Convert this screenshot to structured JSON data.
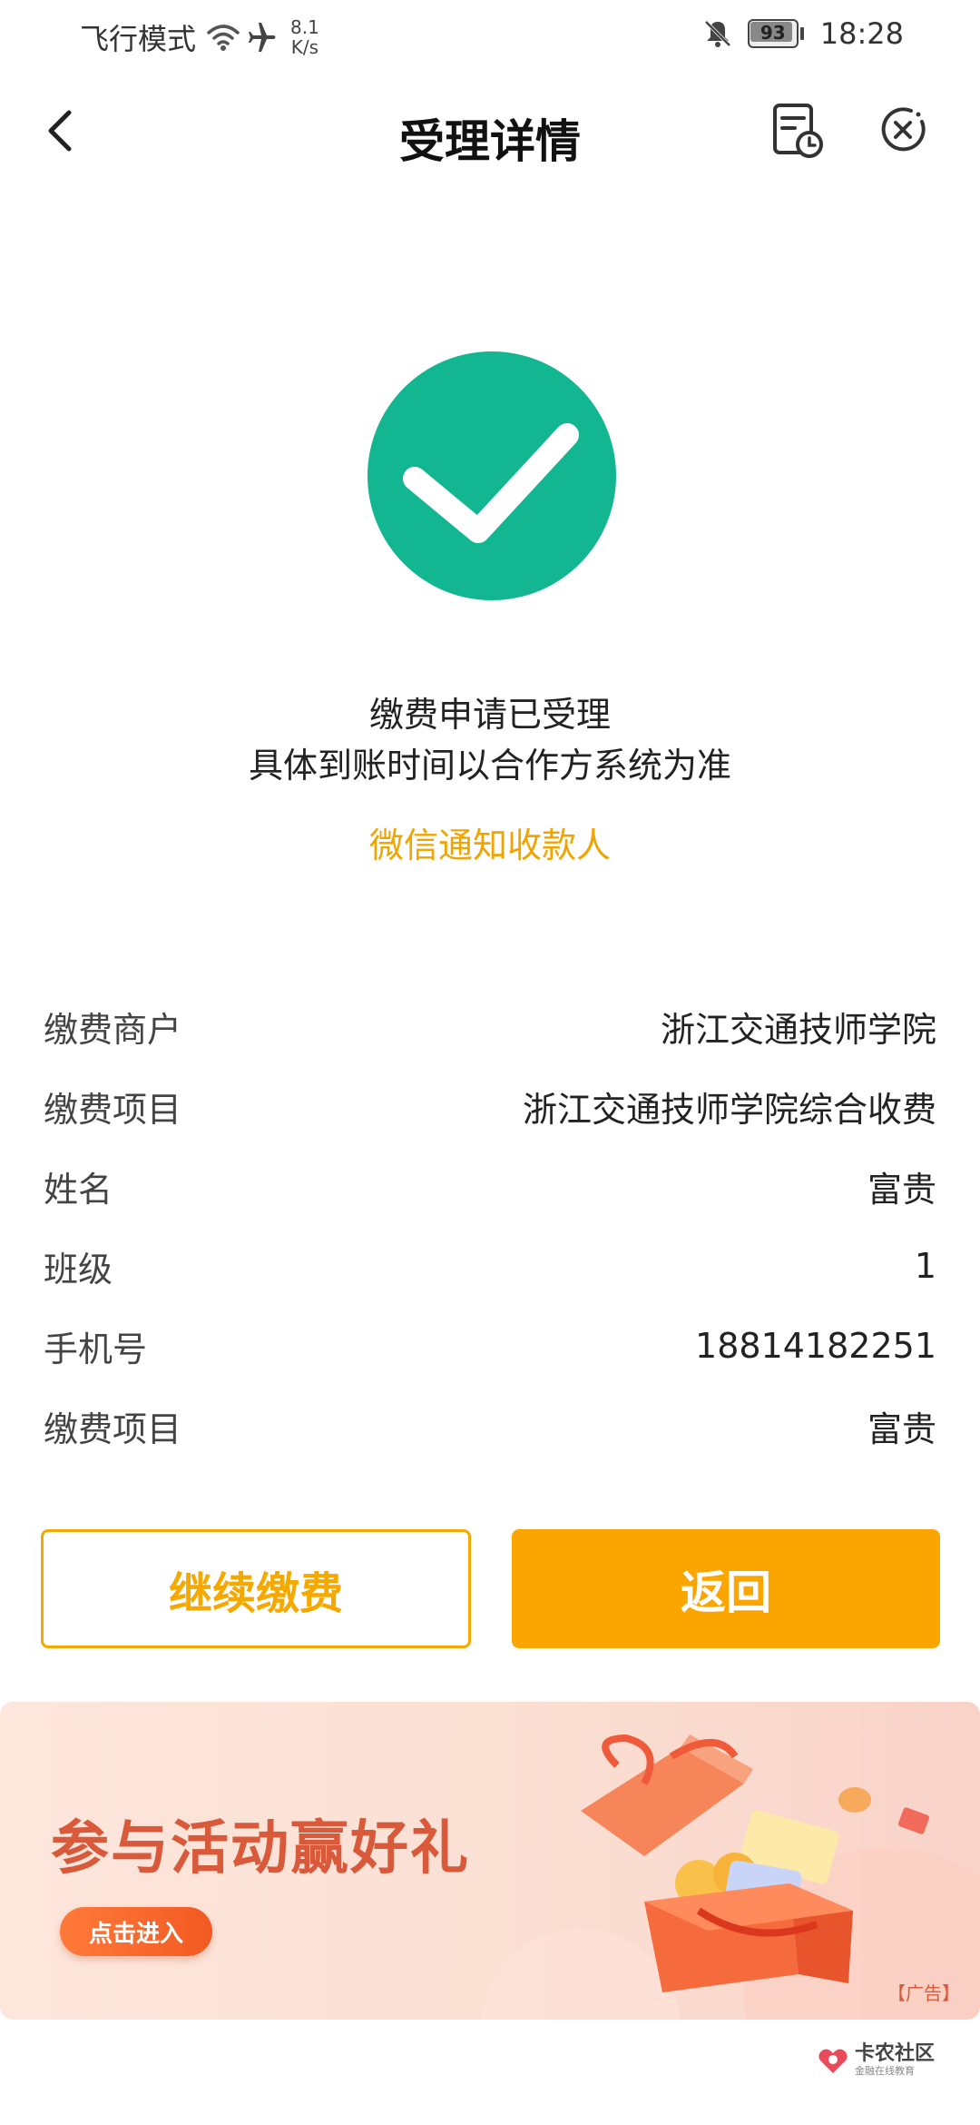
{
  "status_bar": {
    "mode": "飞行模式",
    "speed_value": "8.1",
    "speed_unit": "K/s",
    "battery": "93",
    "time": "18:28",
    "icons": [
      "wifi-icon",
      "airplane-icon",
      "bell-muted-icon",
      "battery-icon"
    ]
  },
  "header": {
    "title": "受理详情",
    "icons": [
      "back-arrow-icon",
      "document-clock-icon",
      "close-circle-icon"
    ]
  },
  "result": {
    "icon": "check-circle-icon",
    "icon_color": "#12b792",
    "line1": "缴费申请已受理",
    "line2": "具体到账时间以合作方系统为准",
    "notify_link": "微信通知收款人",
    "link_color": "#f0a400"
  },
  "details": [
    {
      "key": "缴费商户",
      "value": "浙江交通技师学院"
    },
    {
      "key": "缴费项目",
      "value": "浙江交通技师学院综合收费"
    },
    {
      "key": "姓名",
      "value": "富贵"
    },
    {
      "key": "班级",
      "value": "1"
    },
    {
      "key": "手机号",
      "value": "18814182251"
    },
    {
      "key": "缴费项目",
      "value": "富贵"
    }
  ],
  "actions": {
    "continue_label": "继续缴费",
    "back_label": "返回",
    "accent": "#fba600"
  },
  "banner": {
    "title": "参与活动赢好礼",
    "button": "点击进入",
    "ad_tag": "【广告】"
  },
  "watermark": {
    "title": "卡农社区",
    "subtitle": "金融在线教育"
  }
}
